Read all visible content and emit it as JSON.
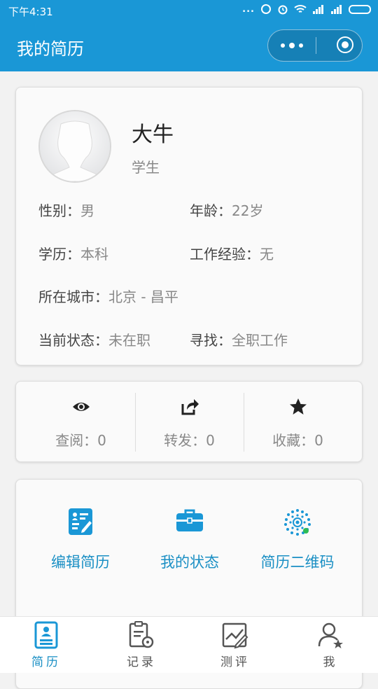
{
  "status_bar": {
    "time": "下午4:31",
    "dots": "..."
  },
  "nav": {
    "title": "我的简历"
  },
  "profile": {
    "name": "大牛",
    "role": "学生",
    "fields": [
      {
        "key": "性别：",
        "value": "男"
      },
      {
        "key": "年龄：",
        "value": "22岁"
      },
      {
        "key": "学历：",
        "value": "本科"
      },
      {
        "key": "工作经验：",
        "value": "无"
      },
      {
        "key": "所在城市：",
        "value": "北京 - 昌平"
      },
      {
        "key": "当前状态：",
        "value": "未在职"
      },
      {
        "key": "寻找：",
        "value": "全职工作"
      }
    ]
  },
  "stats": [
    {
      "icon": "eye-icon",
      "label": "查阅：0"
    },
    {
      "icon": "share-icon",
      "label": "转发：0"
    },
    {
      "icon": "star-icon",
      "label": "收藏：0"
    }
  ],
  "actions": [
    {
      "icon": "edit-resume-icon",
      "label": "编辑简历"
    },
    {
      "icon": "briefcase-icon",
      "label": "我的状态"
    },
    {
      "icon": "qr-code-icon",
      "label": "简历二维码"
    }
  ],
  "tabs": [
    {
      "icon": "resume-icon",
      "label": "简历",
      "active": true
    },
    {
      "icon": "record-icon",
      "label": "记录",
      "active": false
    },
    {
      "icon": "evaluate-icon",
      "label": "测评",
      "active": false
    },
    {
      "icon": "me-icon",
      "label": "我",
      "active": false
    }
  ],
  "colors": {
    "primary": "#1a97d6",
    "accent_text": "#1a8fc4"
  }
}
